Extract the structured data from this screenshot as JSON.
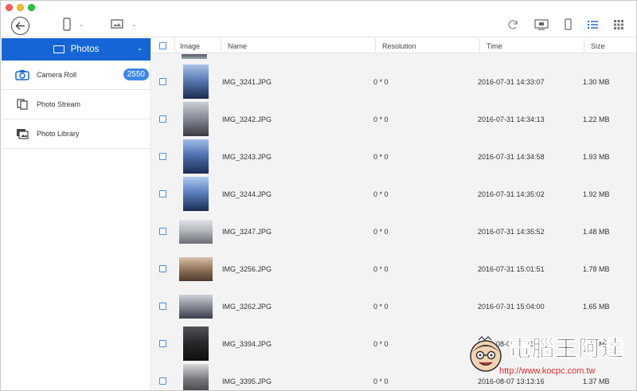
{
  "sidebar": {
    "header": "Photos",
    "items": [
      {
        "label": "Camera Roll",
        "badge": "2550",
        "icon": "camera-icon"
      },
      {
        "label": "Photo Stream",
        "icon": "photo-stream-icon"
      },
      {
        "label": "Photo Library",
        "icon": "photo-library-icon"
      }
    ]
  },
  "table": {
    "columns": [
      "Image",
      "Name",
      "Resolution",
      "Time",
      "Size"
    ],
    "rows": [
      {
        "name": "IMG_3241.JPG",
        "resolution": "0 * 0",
        "time": "2016-07-31 14:33:07",
        "size": "1.30 MB",
        "thumb": "portrait"
      },
      {
        "name": "IMG_3242.JPG",
        "resolution": "0 * 0",
        "time": "2016-07-31 14:34:13",
        "size": "1.22 MB",
        "thumb": "portrait"
      },
      {
        "name": "IMG_3243.JPG",
        "resolution": "0 * 0",
        "time": "2016-07-31 14:34:58",
        "size": "1.93 MB",
        "thumb": "portrait"
      },
      {
        "name": "IMG_3244.JPG",
        "resolution": "0 * 0",
        "time": "2016-07-31 14:35:02",
        "size": "1.92 MB",
        "thumb": "portrait"
      },
      {
        "name": "IMG_3247.JPG",
        "resolution": "0 * 0",
        "time": "2016-07-31 14:35:52",
        "size": "1.48 MB",
        "thumb": "landscape"
      },
      {
        "name": "IMG_3256.JPG",
        "resolution": "0 * 0",
        "time": "2016-07-31 15:01:51",
        "size": "1.78 MB",
        "thumb": "landscape"
      },
      {
        "name": "IMG_3262.JPG",
        "resolution": "0 * 0",
        "time": "2016-07-31 15:04:00",
        "size": "1.65 MB",
        "thumb": "landscape"
      },
      {
        "name": "IMG_3394.JPG",
        "resolution": "0 * 0",
        "time": "2016-08-07 13:13:16",
        "size": "1.47 MB",
        "thumb": "portrait"
      },
      {
        "name": "IMG_3395.JPG",
        "resolution": "0 * 0",
        "time": "2016-08-07 13:13:16",
        "size": "1.37 MB",
        "thumb": "portrait"
      }
    ]
  },
  "watermark": {
    "title": "電腦王阿達",
    "url": "http://www.kocpc.com.tw"
  },
  "colors": {
    "accent": "#1565d6",
    "badge": "#3d87e8",
    "row_bg": "#f3f3f3"
  }
}
